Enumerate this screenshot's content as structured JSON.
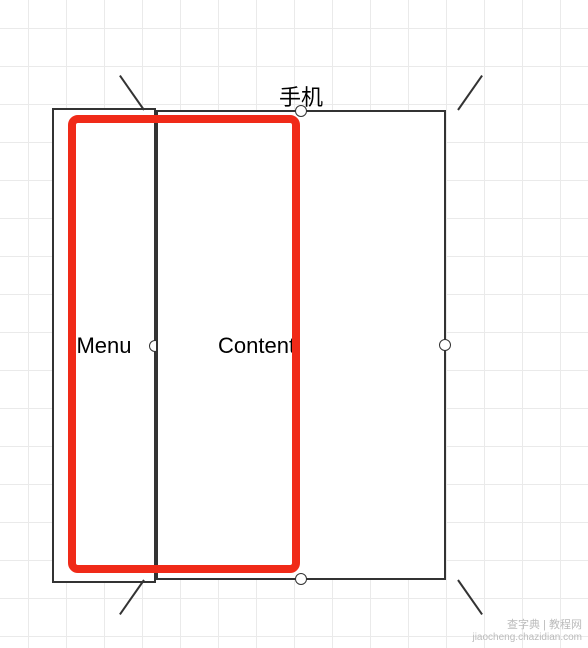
{
  "labels": {
    "phone": "手机",
    "menu": "Menu",
    "content": "Content"
  },
  "watermark": {
    "line1": "查字典 | 教程网",
    "line2": "jiaocheng.chazidian.com"
  }
}
